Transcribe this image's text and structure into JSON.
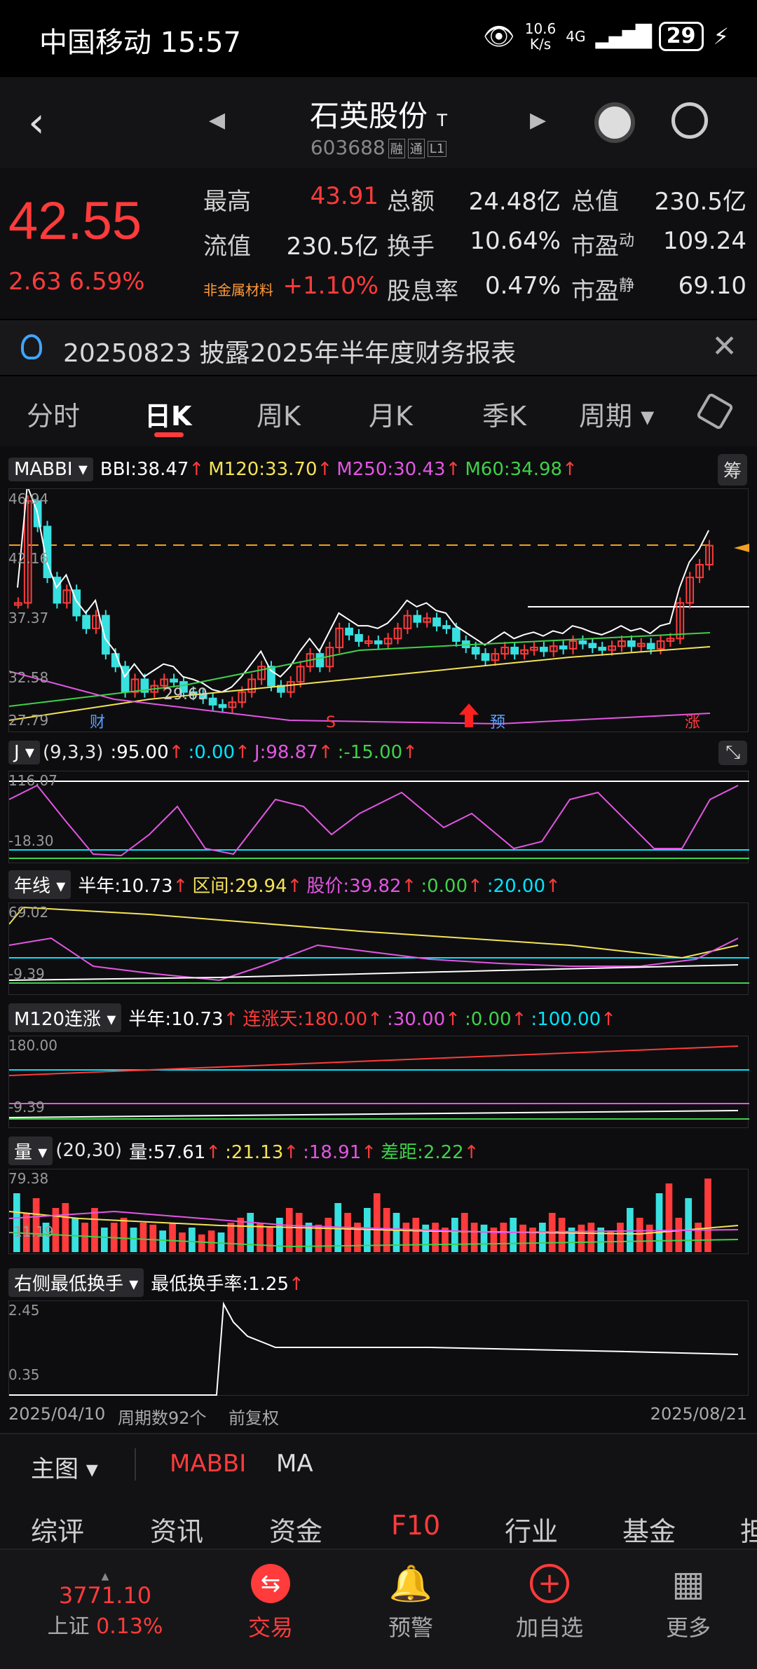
{
  "status": {
    "carrier": "中国移动 15:57",
    "net_speed": "10.6",
    "net_unit": "K/s",
    "signal": "4G",
    "battery": "29"
  },
  "header": {
    "title": "石英股份",
    "title_tag": "T",
    "code": "603688",
    "tags": [
      "融",
      "通",
      "L1"
    ]
  },
  "quote": {
    "price": "42.55",
    "change": "2.63",
    "change_pct": "6.59%",
    "rows": [
      [
        {
          "l": "最高",
          "v": "43.91",
          "red": true
        },
        {
          "l": "总额",
          "v": "24.48亿"
        },
        {
          "l": "总值",
          "v": "230.5亿"
        }
      ],
      [
        {
          "l": "流值",
          "v": "230.5亿"
        },
        {
          "l": "换手",
          "v": "10.64%"
        },
        {
          "l": "市盈",
          "sup": "动",
          "v": "109.24"
        }
      ],
      [
        {
          "l": "非金属材料",
          "v": "+1.10%",
          "red": true,
          "small": true
        },
        {
          "l": "股息率",
          "v": "0.47%"
        },
        {
          "l": "市盈",
          "sup": "静",
          "v": "69.10"
        }
      ]
    ]
  },
  "notice": {
    "text": "20250823 披露2025年半年度财务报表"
  },
  "tabs": [
    "分时",
    "日K",
    "周K",
    "月K",
    "季K",
    "周期"
  ],
  "main_ind": {
    "name": "MABBI",
    "items": [
      {
        "t": "BBI:38.47",
        "c": "#ffffff"
      },
      {
        "t": "M120:33.70",
        "c": "#f5e356"
      },
      {
        "t": "M250:30.43",
        "c": "#e356e3"
      },
      {
        "t": "M60:34.98",
        "c": "#3fd14a"
      }
    ],
    "right": "筹"
  },
  "kline_axis": [
    "46.94",
    "42.16",
    "37.37",
    "32.58",
    "27.79"
  ],
  "kline_marks": {
    "low": "29.69",
    "cai": "财",
    "s": "S",
    "yu": "预",
    "zhang": "涨"
  },
  "j_ind": {
    "name": "J",
    "params": "(9,3,3)",
    "items": [
      {
        "t": ":95.00",
        "c": "#ffffff"
      },
      {
        "t": ":0.00",
        "c": "#00e5ff"
      },
      {
        "t": "J:98.87",
        "c": "#e356e3"
      },
      {
        "t": ":-15.00",
        "c": "#3fd14a"
      }
    ],
    "axis": [
      "116.07",
      "-18.30"
    ]
  },
  "nian_ind": {
    "name": "年线",
    "items": [
      {
        "t": "半年:10.73",
        "c": "#ffffff"
      },
      {
        "t": "区间:29.94",
        "c": "#f5e356"
      },
      {
        "t": "股价:39.82",
        "c": "#e356e3"
      },
      {
        "t": ":0.00",
        "c": "#3fd14a"
      },
      {
        "t": ":20.00",
        "c": "#00e5ff"
      }
    ],
    "axis": [
      "69.02",
      "-9.39"
    ]
  },
  "m120_ind": {
    "name": "M120连涨",
    "items": [
      {
        "t": "半年:10.73",
        "c": "#ffffff"
      },
      {
        "t": "连涨天:180.00",
        "c": "#ff3b3b"
      },
      {
        "t": ":30.00",
        "c": "#e356e3"
      },
      {
        "t": ":0.00",
        "c": "#3fd14a"
      },
      {
        "t": ":100.00",
        "c": "#00e5ff"
      }
    ],
    "axis": [
      "180.00",
      "-9.39"
    ]
  },
  "vol_ind": {
    "name": "量",
    "params": "(20,30)",
    "items": [
      {
        "t": "量:57.61",
        "c": "#ffffff"
      },
      {
        "t": ":21.13",
        "c": "#f5e356"
      },
      {
        "t": ":18.91",
        "c": "#e356e3"
      },
      {
        "t": "差距:2.22",
        "c": "#3fd14a"
      }
    ],
    "axis": [
      "79.38",
      "-11.19"
    ]
  },
  "turn_ind": {
    "name": "右侧最低换手",
    "items": [
      {
        "t": "最低换手率:1.25",
        "c": "#ffffff"
      }
    ],
    "axis": [
      "2.45",
      "0.35"
    ]
  },
  "footer_axis": {
    "start": "2025/04/10",
    "count": "周期数92个",
    "adj": "前复权",
    "end": "2025/08/21"
  },
  "bottombar": {
    "main": "主图",
    "opts": [
      "MABBI",
      "MA"
    ]
  },
  "f10": [
    "综评",
    "资讯",
    "资金",
    "F10",
    "行业",
    "基金",
    "担"
  ],
  "nav": {
    "index_val": "3771.10",
    "index_name": "上证",
    "index_pct": "0.13%",
    "items": [
      "交易",
      "预警",
      "加自选",
      "更多"
    ]
  }
}
